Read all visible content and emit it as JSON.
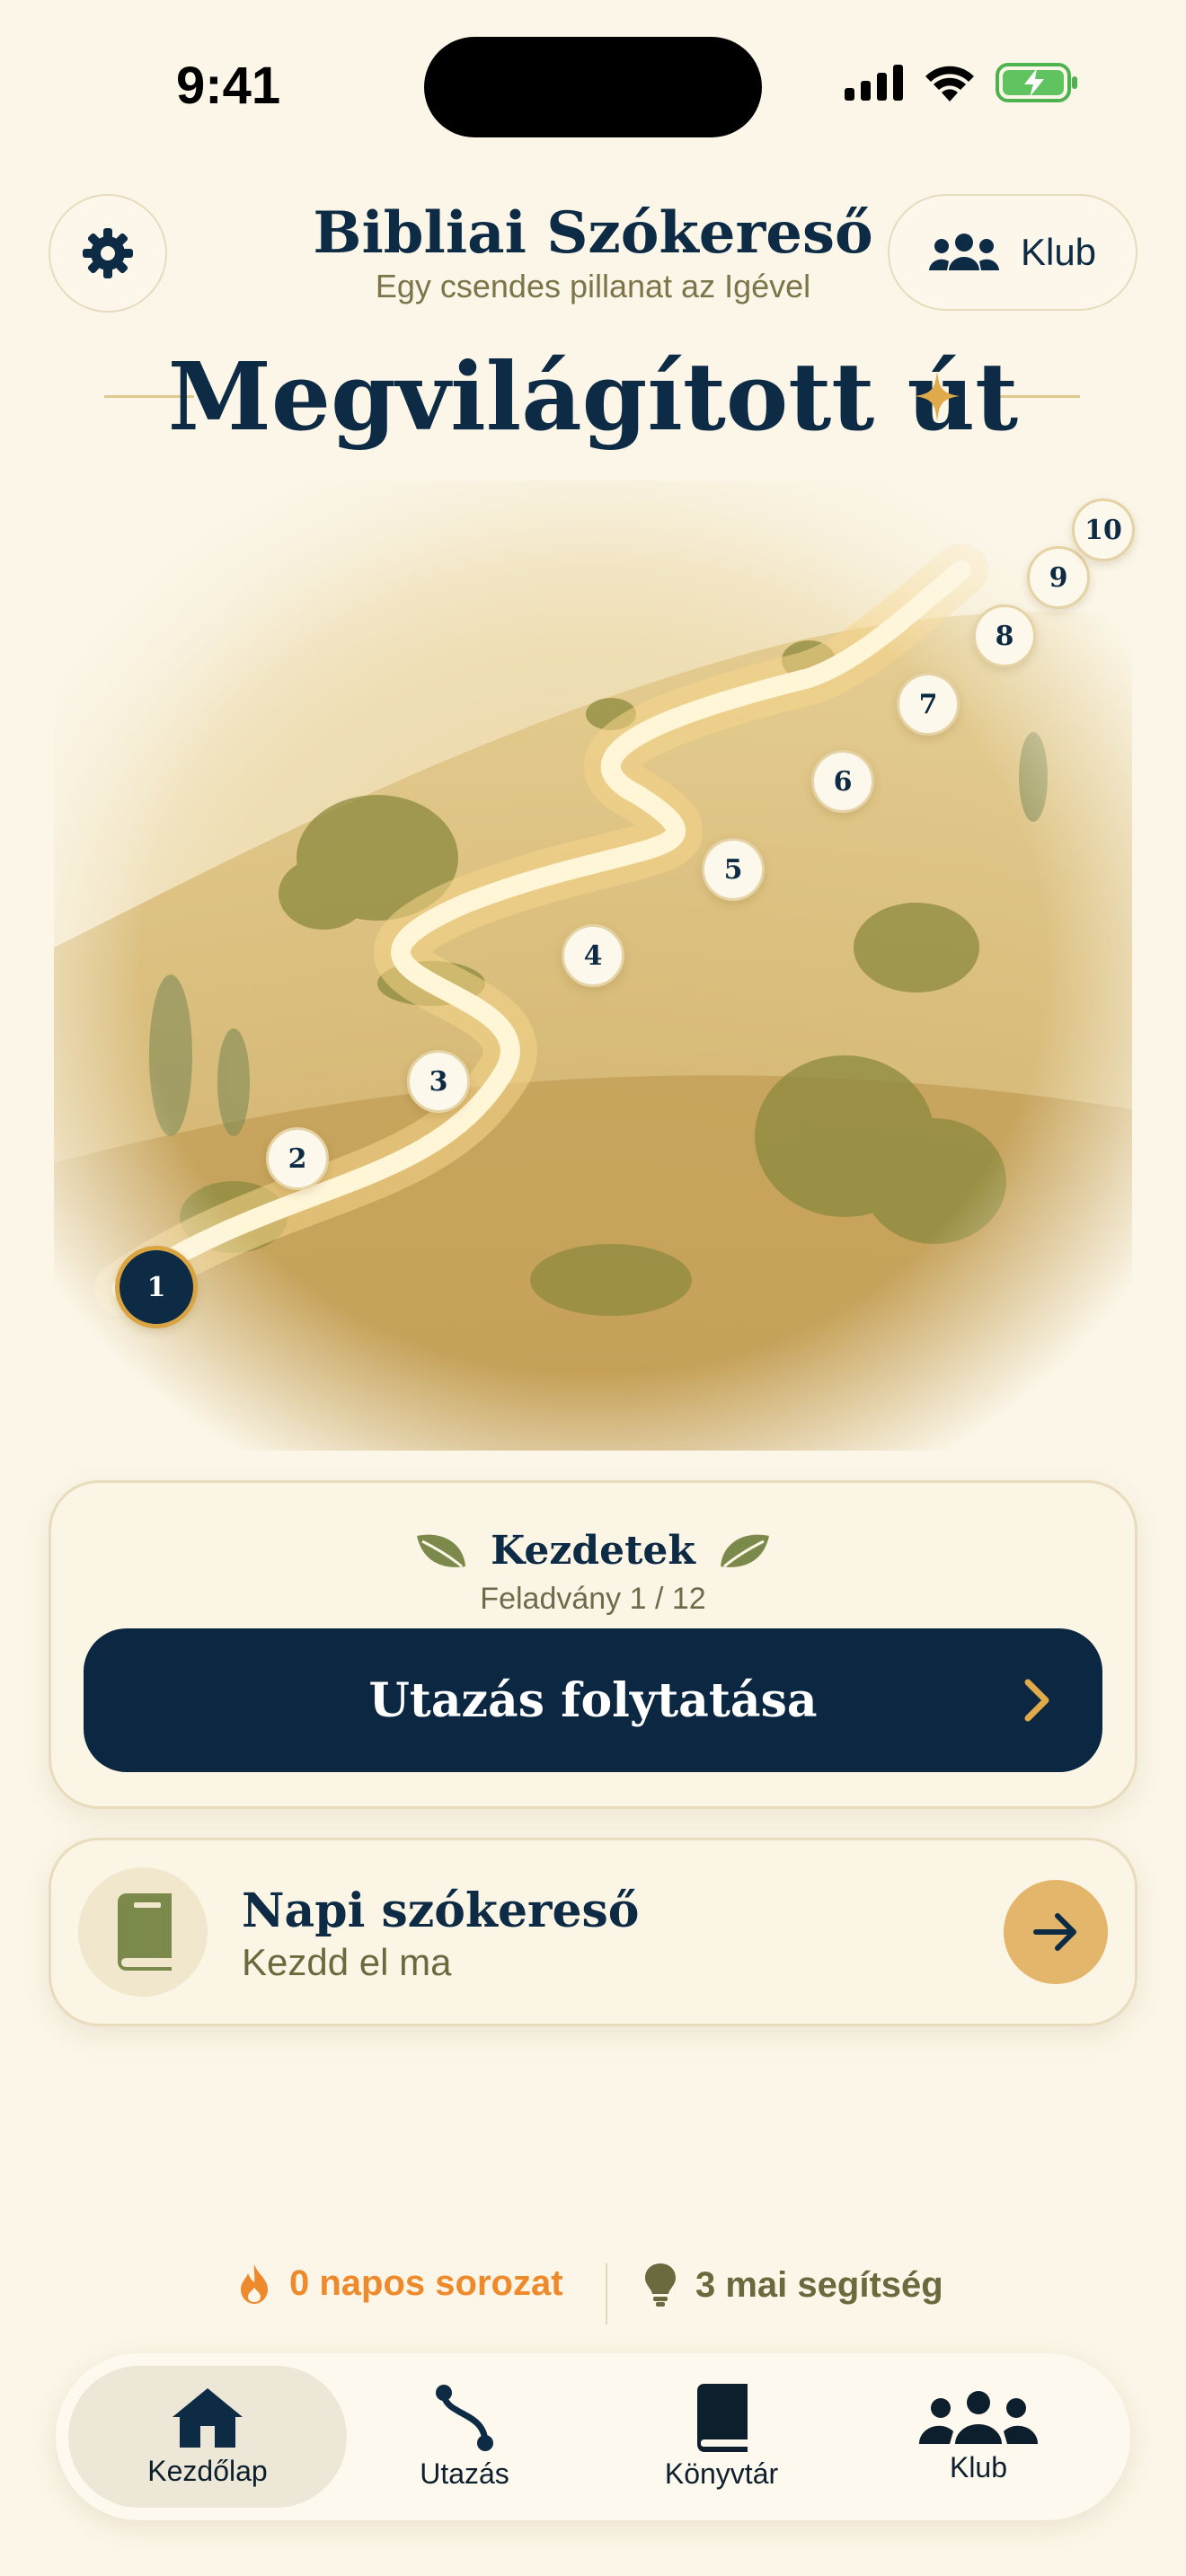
{
  "status_bar": {
    "time": "9:41"
  },
  "header": {
    "title": "Bibliai Szókereső",
    "subtitle": "Egy csendes pillanat az Igével",
    "settings_icon": "gear-icon",
    "club_label": "Klub",
    "club_icon": "people-icon"
  },
  "journey": {
    "title": "Megvilágított út",
    "current_level": 1,
    "levels": [
      "1",
      "2",
      "3",
      "4",
      "5",
      "6",
      "7",
      "8",
      "9",
      "10"
    ]
  },
  "chapter_card": {
    "name": "Kezdetek",
    "progress": "Feladvány 1 / 12",
    "continue_label": "Utazás folytatása"
  },
  "daily_card": {
    "title": "Napi szókereső",
    "subtitle": "Kezdd el ma",
    "icon": "book-icon"
  },
  "stats": {
    "streak": "0 napos sorozat",
    "hints": "3 mai segítség"
  },
  "tabs": [
    {
      "label": "Kezdőlap",
      "icon": "home-icon",
      "active": true
    },
    {
      "label": "Utazás",
      "icon": "route-icon",
      "active": false
    },
    {
      "label": "Könyvtár",
      "icon": "book-icon",
      "active": false
    },
    {
      "label": "Klub",
      "icon": "people-icon",
      "active": false
    }
  ],
  "colors": {
    "navy": "#0b2742",
    "gold": "#d9a441",
    "olive": "#6b6a3e",
    "streak": "#ef8a2c",
    "background": "#fbf6e8"
  }
}
